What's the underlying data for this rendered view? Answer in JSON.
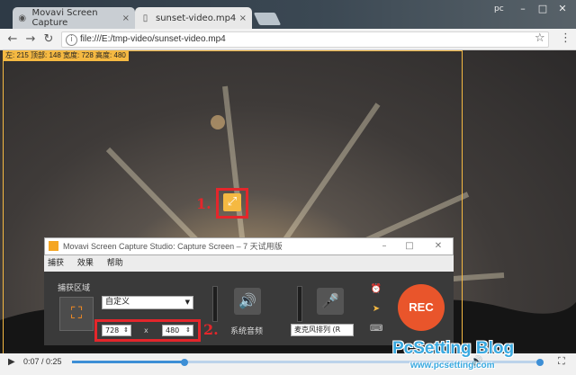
{
  "browser": {
    "tabs": [
      {
        "label": "Movavi Screen Capture",
        "icon": "movavi-tab-icon"
      },
      {
        "label": "sunset-video.mp4",
        "icon": "file-tab-icon"
      }
    ],
    "profile_label": "pc",
    "url": "file:///E:/tmp-video/sunset-video.mp4",
    "close_glyph": "×"
  },
  "capture_region": {
    "coords_text": "左: 215 顶部: 148 宽度: 728 高度: 480"
  },
  "annotations": {
    "step1": "1.",
    "step2": "2."
  },
  "movavi": {
    "title": "Movavi Screen Capture Studio: Capture Screen – 7 天试用版",
    "menu": [
      "捕获",
      "效果",
      "帮助"
    ],
    "capture_area_label": "捕获区域",
    "preset_value": "自定义",
    "width_value": "728",
    "height_value": "480",
    "times_sign": "x",
    "system_audio_label": "系统音频",
    "mic_value": "麦克风排列 (R",
    "rec_label": "REC"
  },
  "player": {
    "time": "0:07 / 0:25",
    "progress": 0.24
  },
  "watermark": {
    "title": "PcSetting Blog",
    "url": "www.pcsetting.com"
  },
  "colors": {
    "accent_orange": "#f5b942",
    "annotation_red": "#e4262b",
    "rec_button": "#e9552b",
    "progress_blue": "#3d8fd6"
  }
}
